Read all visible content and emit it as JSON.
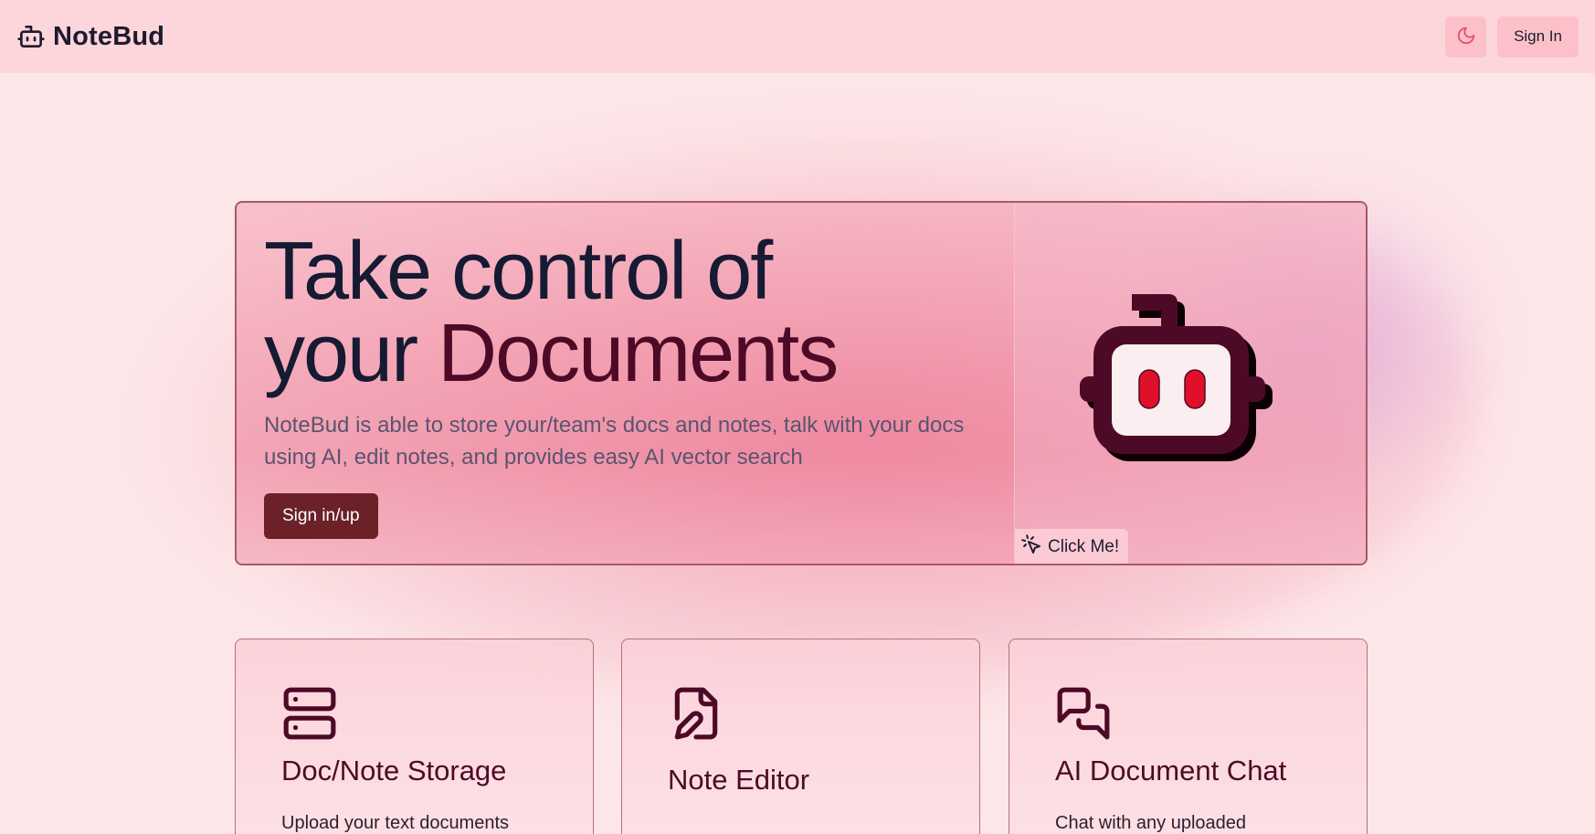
{
  "header": {
    "brand_name": "NoteBud",
    "signin_label": "Sign In"
  },
  "hero": {
    "title_line1": "Take control of",
    "title_line2_prefix": "your",
    "title_line2_accent": "Documents",
    "description": "NoteBud is able to store your/team's docs and notes, talk with your docs using AI, edit notes, and provides easy AI vector search",
    "cta_label": "Sign in/up",
    "click_me_label": "Click Me!"
  },
  "features": [
    {
      "title": "Doc/Note Storage",
      "description": "Upload your text documents",
      "icon": "server-icon"
    },
    {
      "title": "Note Editor",
      "description": "",
      "icon": "file-pen-icon"
    },
    {
      "title": "AI Document Chat",
      "description": "Chat with any uploaded",
      "icon": "messages-icon"
    }
  ],
  "colors": {
    "background": "#fde6e8",
    "header_bg": "#fdd6db",
    "accent_dark": "#4d0a26",
    "cta_bg": "#6b2127",
    "moon_icon": "#e8506b",
    "robot_eyes": "#e0102a"
  }
}
